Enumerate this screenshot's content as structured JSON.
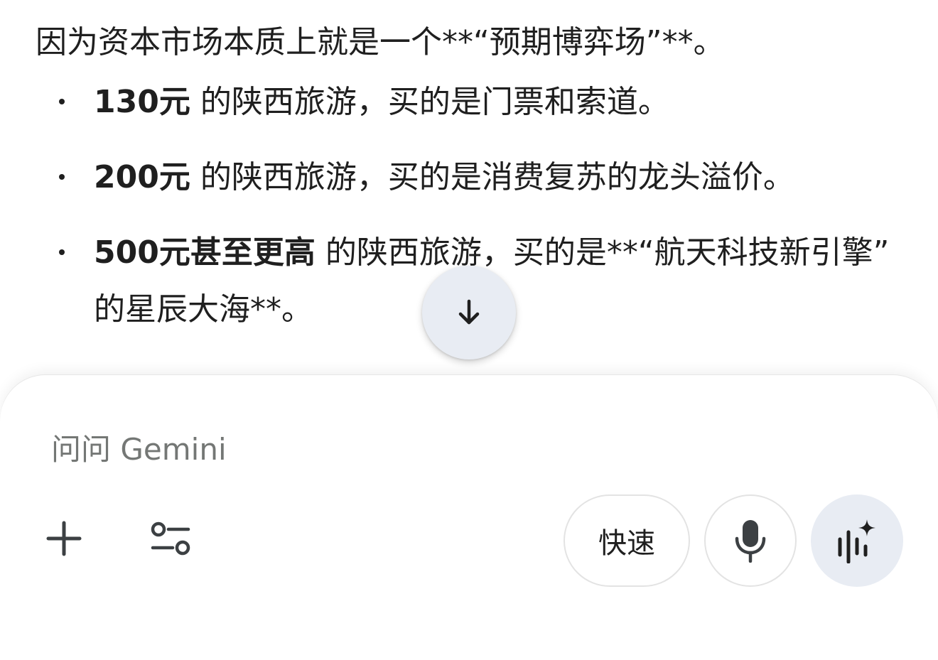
{
  "response": {
    "intro": "因为资本市场本质上就是一个**“预期博弈场”**。",
    "bullets": [
      {
        "strong": "130元",
        "text": " 的陕西旅游，买的是门票和索道。"
      },
      {
        "strong": "200元",
        "text": " 的陕西旅游，买的是消费复苏的龙头溢价。"
      },
      {
        "strong": "500元甚至更高",
        "text": " 的陕西旅游，买的是**“航天科技新引擎” 的星辰大海**。"
      }
    ]
  },
  "scroll_button": {
    "icon": "arrow-down-icon"
  },
  "composer": {
    "placeholder": "问问 Gemini",
    "value": "",
    "add_icon": "plus-icon",
    "tools_icon": "tune-icon",
    "mode_label": "快速",
    "mic_icon": "mic-icon",
    "live_icon": "live-sparkle-icon"
  },
  "colors": {
    "text": "#1f1f1f",
    "placeholder": "#747775",
    "fab_bg": "#e8ecf3",
    "border": "#e3e3e3"
  }
}
